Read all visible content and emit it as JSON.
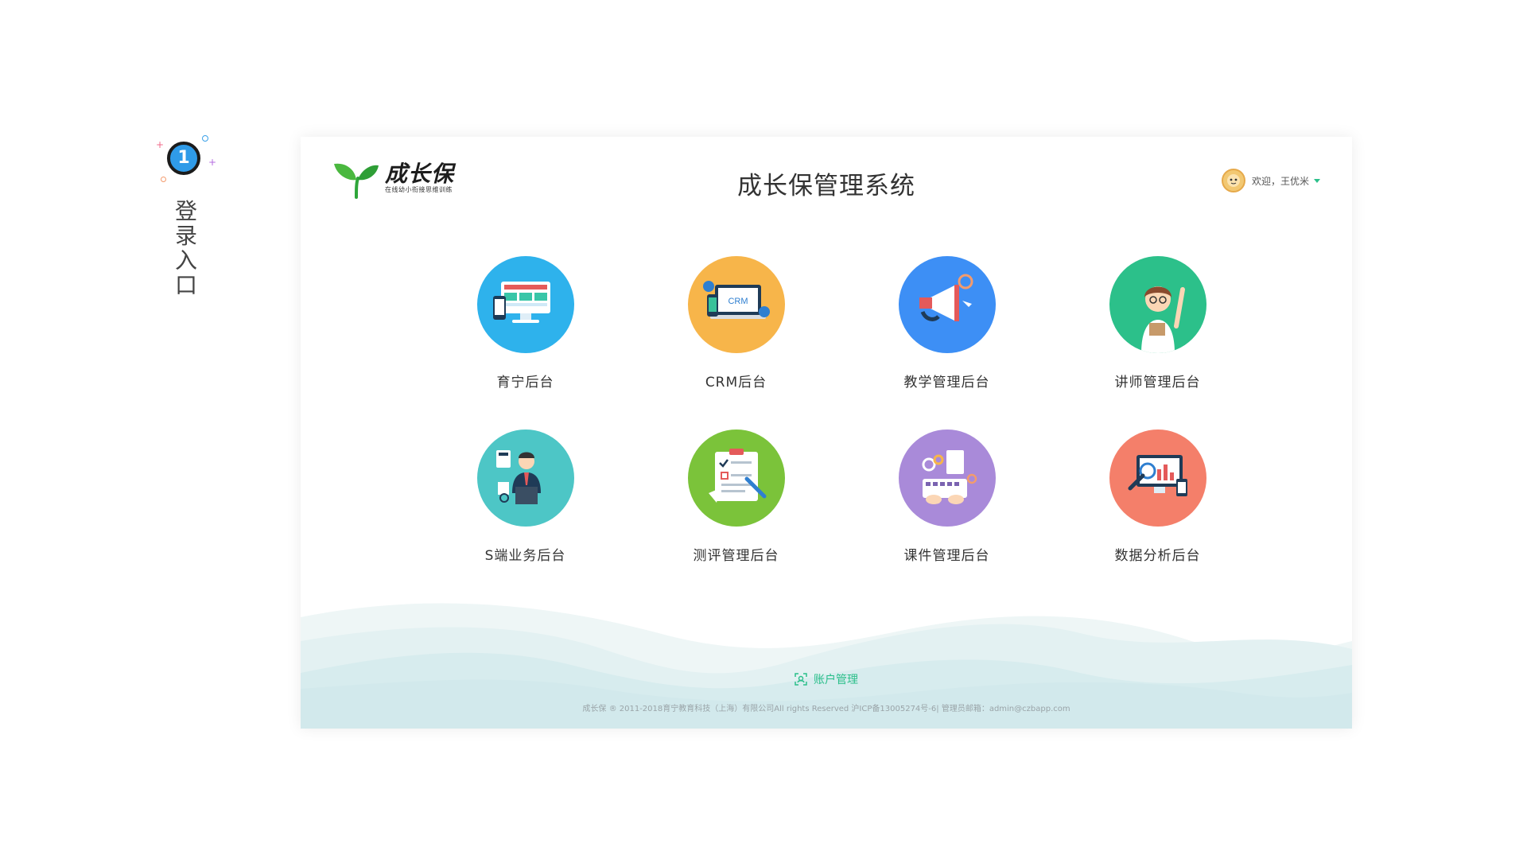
{
  "step": {
    "number": "1",
    "label": "登录入口"
  },
  "header": {
    "logo_name": "成长保",
    "logo_subtitle": "在线幼小衔接思维训练",
    "title": "成长保管理系统",
    "user_greeting": "欢迎，王优米"
  },
  "modules": [
    {
      "label": "育宁后台",
      "icon": "monitor-devices-icon",
      "color": "#2eb2ec"
    },
    {
      "label": "CRM后台",
      "icon": "crm-laptop-icon",
      "color": "#f7b54a"
    },
    {
      "label": "教学管理后台",
      "icon": "megaphone-icon",
      "color": "#3d8ff5"
    },
    {
      "label": "讲师管理后台",
      "icon": "teacher-icon",
      "color": "#2cc08a"
    },
    {
      "label": "S端业务后台",
      "icon": "business-man-icon",
      "color": "#4dc6c6"
    },
    {
      "label": "测评管理后台",
      "icon": "evaluation-checklist-icon",
      "color": "#7bc33a"
    },
    {
      "label": "课件管理后台",
      "icon": "courseware-keyboard-icon",
      "color": "#a98ad9"
    },
    {
      "label": "数据分析后台",
      "icon": "data-analysis-icon",
      "color": "#f47f6a"
    }
  ],
  "footer": {
    "account_label": "账户管理",
    "copyright": "成长保 ® 2011-2018育宁教育科技（上海）有限公司All rights Reserved 沪ICP备13005274号-6|  管理员邮箱：admin@czbapp.com"
  },
  "colors": {
    "accent_green": "#2bbf8a",
    "step_blue": "#2f9be8"
  }
}
